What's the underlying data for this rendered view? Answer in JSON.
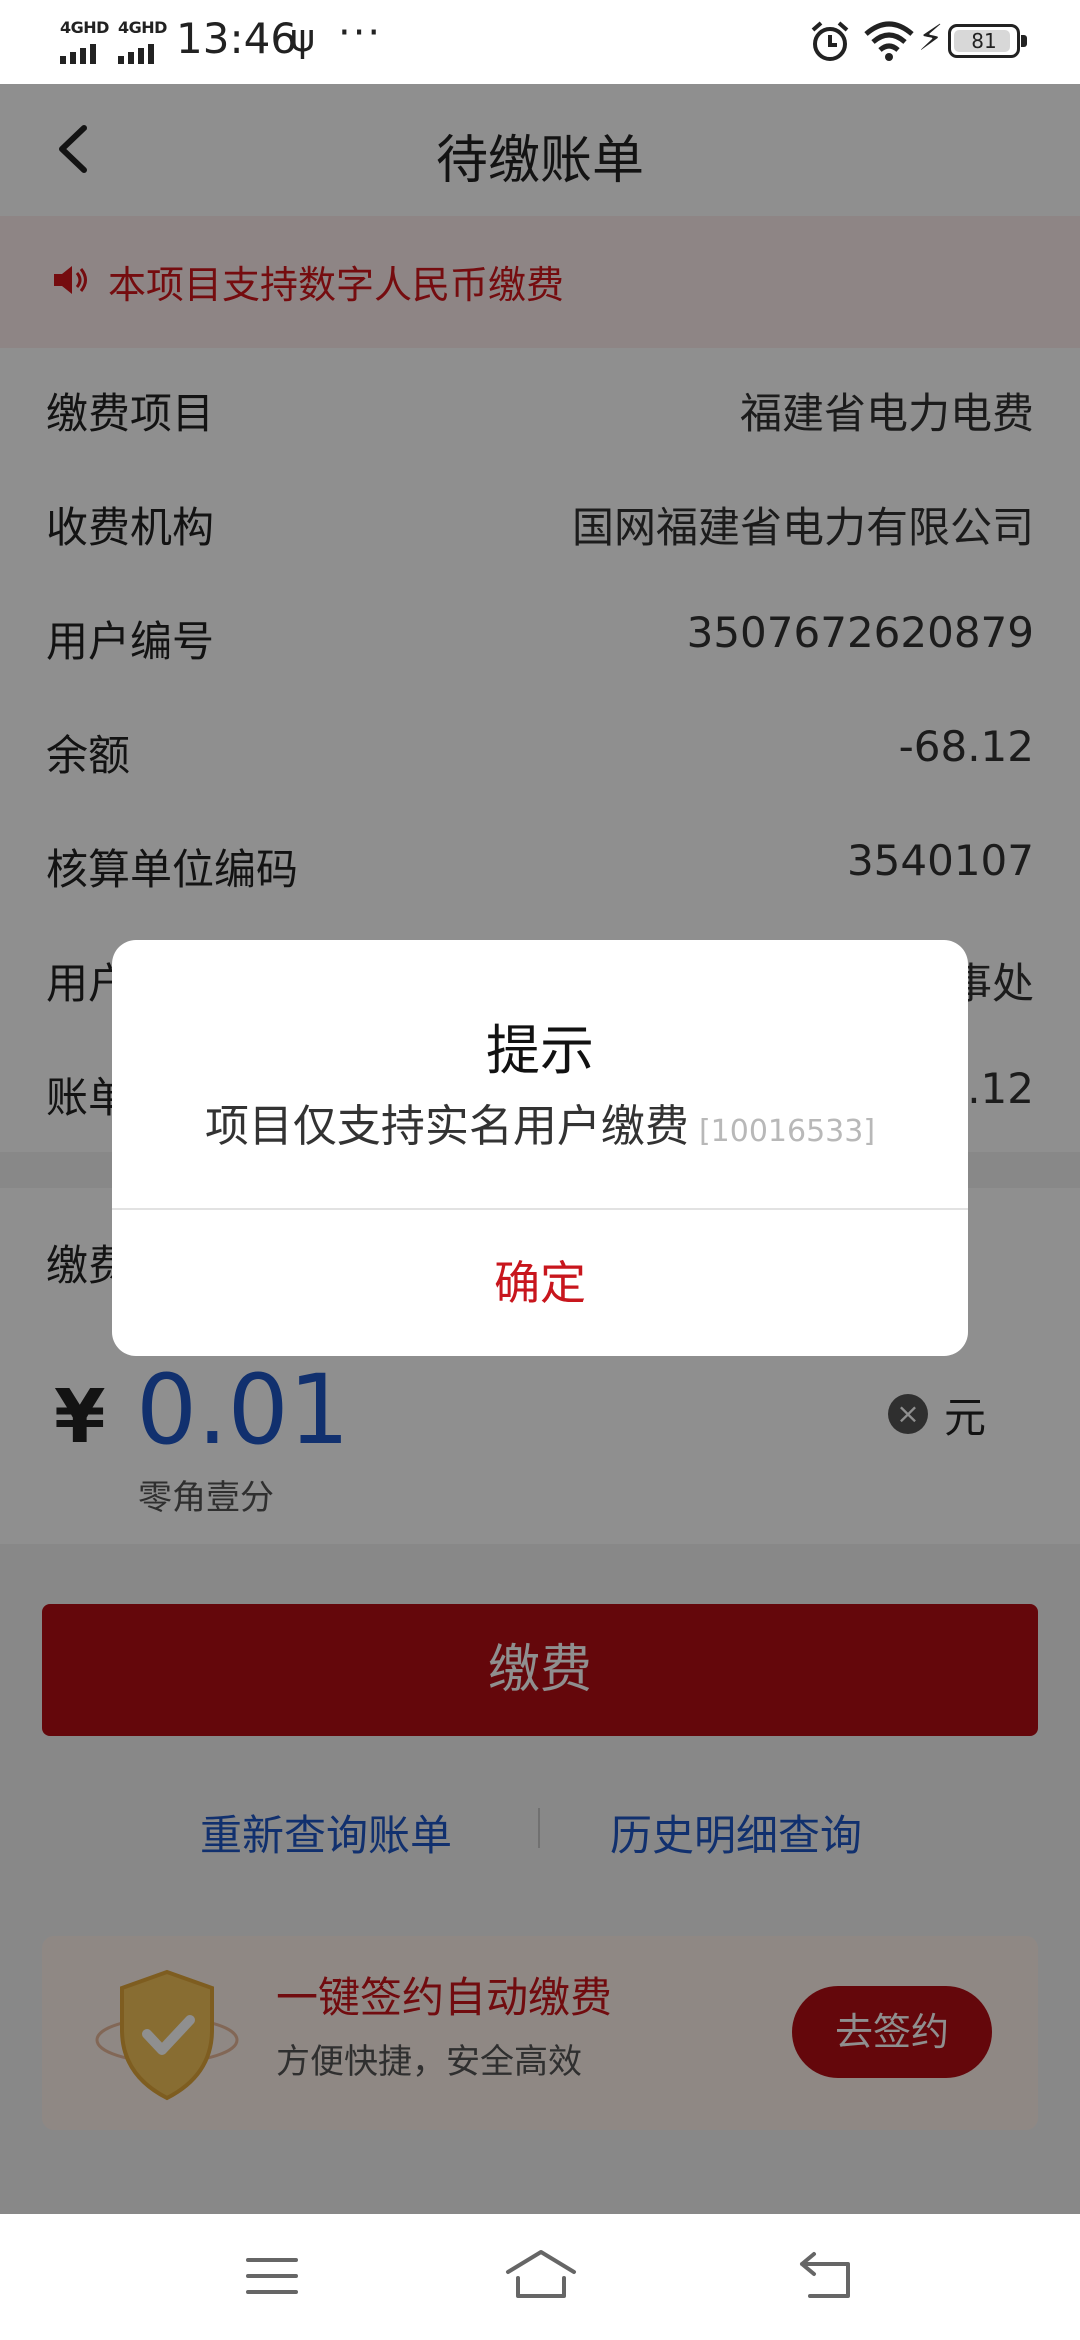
{
  "status_bar": {
    "net1": "4GHD",
    "net2": "4GHD",
    "time": "13:46",
    "usb": "ψ",
    "more": "···",
    "battery": "81"
  },
  "header": {
    "title": "待缴账单"
  },
  "notice": {
    "text": "本项目支持数字人民币缴费"
  },
  "bill_rows": [
    {
      "label": "缴费项目",
      "value": "福建省电力电费"
    },
    {
      "label": "收费机构",
      "value": "国网福建省电力有限公司"
    },
    {
      "label": "用户编号",
      "value": "3507672620879"
    },
    {
      "label": "余额",
      "value": "-68.12"
    },
    {
      "label": "核算单位编码",
      "value": "3540107"
    },
    {
      "label": "用户",
      "value": "事处"
    },
    {
      "label": "账单",
      "value": ".12"
    }
  ],
  "amount": {
    "label": "缴费",
    "currency_symbol": "¥",
    "value": "0.01",
    "in_words": "零角壹分",
    "unit": "元"
  },
  "actions": {
    "pay_label": "缴费",
    "requery_label": "重新查询账单",
    "history_label": "历史明细查询"
  },
  "promo": {
    "title": "一键签约自动缴费",
    "subtitle": "方便快捷，安全高效",
    "button_label": "去签约"
  },
  "dialog": {
    "title": "提示",
    "message": "项目仅支持实名用户缴费",
    "code": "[10016533]",
    "ok_label": "确定"
  },
  "colors": {
    "accent_red": "#b30e14",
    "link_blue": "#1f57c4",
    "notice_bg": "#fdeeee"
  }
}
